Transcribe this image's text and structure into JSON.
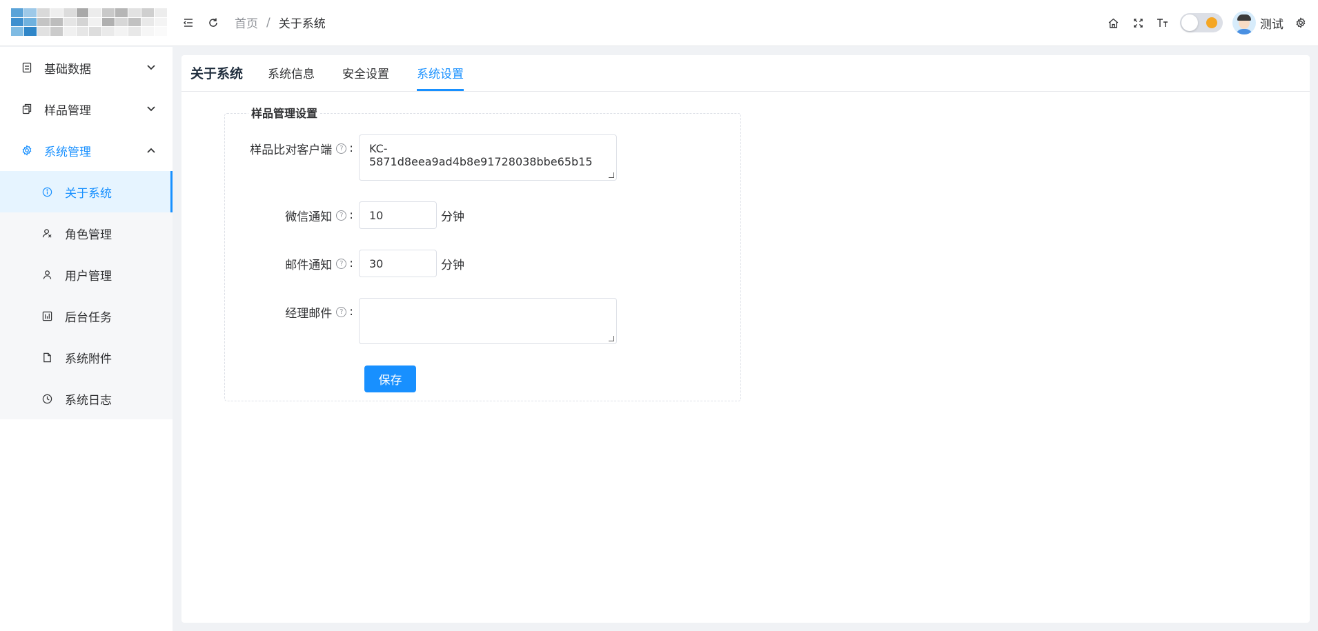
{
  "header": {
    "breadcrumb": {
      "home": "首页",
      "separator": "/",
      "current": "关于系统"
    },
    "user": {
      "name": "测试"
    },
    "icons": [
      "fold-menu-icon",
      "refresh-icon",
      "home-icon",
      "fullscreen-icon",
      "font-size-icon",
      "settings-icon"
    ]
  },
  "sidebar": {
    "items": [
      {
        "label": "基础数据",
        "icon": "list-icon",
        "expanded": false
      },
      {
        "label": "样品管理",
        "icon": "copy-icon",
        "expanded": false
      },
      {
        "label": "系统管理",
        "icon": "gear-icon",
        "expanded": true,
        "children": [
          {
            "label": "关于系统",
            "icon": "info-icon",
            "active": true
          },
          {
            "label": "角色管理",
            "icon": "role-icon"
          },
          {
            "label": "用户管理",
            "icon": "user-icon"
          },
          {
            "label": "后台任务",
            "icon": "task-icon"
          },
          {
            "label": "系统附件",
            "icon": "file-icon"
          },
          {
            "label": "系统日志",
            "icon": "clock-icon"
          }
        ]
      }
    ]
  },
  "main": {
    "title": "关于系统",
    "tabs": [
      {
        "label": "系统信息"
      },
      {
        "label": "安全设置"
      },
      {
        "label": "系统设置",
        "active": true
      }
    ],
    "fieldset": {
      "legend": "样品管理设置",
      "fields": {
        "client": {
          "label": "样品比对客户端",
          "value": "KC-5871d8eea9ad4b8e91728038bbe65b15"
        },
        "wechat": {
          "label": "微信通知",
          "value": "10",
          "unit": "分钟"
        },
        "email": {
          "label": "邮件通知",
          "value": "30",
          "unit": "分钟"
        },
        "manager": {
          "label": "经理邮件",
          "value": ""
        }
      },
      "colon": ":",
      "help_mark": "?",
      "save_label": "保存"
    }
  },
  "colors": {
    "primary": "#1890ff",
    "text": "#303133",
    "muted": "#909399",
    "background": "#f0f2f5"
  }
}
